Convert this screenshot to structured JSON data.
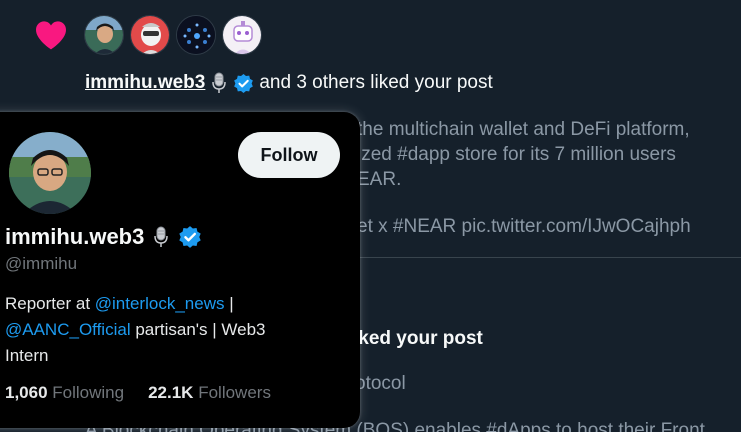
{
  "notification1": {
    "type_icon": "heart-icon",
    "liker_avatars": [
      "avatar-immihu",
      "avatar-mask",
      "avatar-dots",
      "avatar-robot"
    ],
    "username": "immihu.web3",
    "username_emoji": "microphone-icon",
    "verified": true,
    "liked_suffix": "and 3 others liked your post",
    "post_lines": [
      "the multichain wallet and DeFi platform,",
      "ized #dapp store for its 7 million users",
      "EAR."
    ],
    "post_link_line": "et x #NEAR pic.twitter.com/IJwOCajhph"
  },
  "notification2": {
    "liked_suffix": "iked your post",
    "post_line_1": "otocol",
    "post_line_2": "A Blockchain Operating System (BOS) enables #dApps to host their Front"
  },
  "hover_card": {
    "name": "immihu.web3",
    "handle": "@immihu",
    "follow_label": "Follow",
    "bio": {
      "prefix": "Reporter at ",
      "mention1": "@interlock_news",
      "sep": " |",
      "mention2": "@AANC_Official",
      "suffix": " partisan's | Web3",
      "line3": "Intern"
    },
    "following_count": "1,060",
    "following_label": "Following",
    "followers_count": "22.1K",
    "followers_label": "Followers"
  },
  "colors": {
    "background": "#15202b",
    "card_background": "#000000",
    "accent": "#1d9bf0",
    "heart": "#f91880",
    "muted_text": "#8b98a5"
  }
}
